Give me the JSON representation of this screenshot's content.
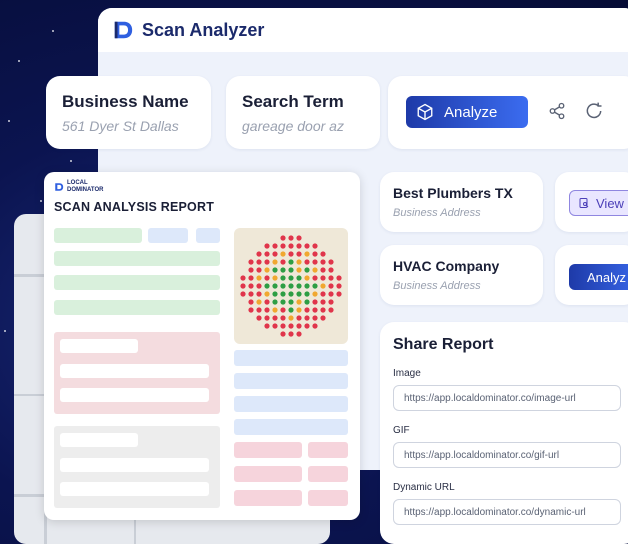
{
  "app": {
    "title": "Scan Analyzer"
  },
  "search": {
    "business_name": {
      "label": "Business Name",
      "value": "561 Dyer St Dallas"
    },
    "search_term": {
      "label": "Search Term",
      "value": "gareage door az"
    },
    "analyze_label": "Analyze"
  },
  "businesses": [
    {
      "name": "Best Plumbers TX",
      "address": "Business Address",
      "action": "View"
    },
    {
      "name": "HVAC Company",
      "address": "Business Address",
      "action": "Analyz"
    }
  ],
  "share": {
    "title": "Share Report",
    "fields": [
      {
        "label": "Image",
        "url": "https://app.localdominator.co/image-url"
      },
      {
        "label": "GIF",
        "url": "https://app.localdominator.co/gif-url"
      },
      {
        "label": "Dynamic URL",
        "url": "https://app.localdominator.co/dynamic-url"
      }
    ]
  },
  "report": {
    "brand_line1": "LOCAL",
    "brand_line2": "DOMINATOR",
    "title": "SCAN ANALYSIS REPORT"
  },
  "colors": {
    "brand": "#1b2a6b",
    "accent": "#3b6cf0",
    "background": "#0b1450"
  }
}
